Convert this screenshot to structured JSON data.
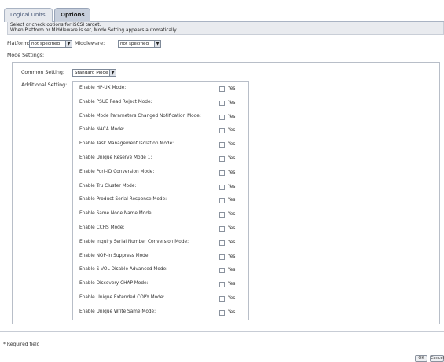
{
  "tabs": [
    {
      "label": "Logical Units",
      "active": false
    },
    {
      "label": "Options",
      "active": true
    }
  ],
  "info": {
    "line1": "Select or check options for iSCSI target.",
    "line2": "When Platform or Middleware is set, Mode Setting appears automatically."
  },
  "platform": {
    "label": "Platform:",
    "value": "not specified"
  },
  "middleware": {
    "label": "Middleware:",
    "value": "not specified"
  },
  "mode_settings_label": "Mode Settings:",
  "common_setting": {
    "label": "Common Setting:",
    "value": "Standard Mode"
  },
  "additional_setting_label": "Additional Setting:",
  "checkbox_yes_label": "Yes",
  "additional_settings": [
    {
      "label": "Enable HP-UX Mode:",
      "checked": false
    },
    {
      "label": "Enable PSUE Read Reject Mode:",
      "checked": false
    },
    {
      "label": "Enable Mode Parameters Changed Notification Mode:",
      "checked": false
    },
    {
      "label": "Enable NACA Mode:",
      "checked": false
    },
    {
      "label": "Enable Task Management Isolation Mode:",
      "checked": false
    },
    {
      "label": "Enable Unique Reserve Mode 1:",
      "checked": false
    },
    {
      "label": "Enable Port-ID Conversion Mode:",
      "checked": false
    },
    {
      "label": "Enable Tru Cluster Mode:",
      "checked": false
    },
    {
      "label": "Enable Product Serial Response Mode:",
      "checked": false
    },
    {
      "label": "Enable Same Node Name Mode:",
      "checked": false
    },
    {
      "label": "Enable CCHS Mode:",
      "checked": false
    },
    {
      "label": "Enable Inquiry Serial Number Conversion Mode:",
      "checked": false
    },
    {
      "label": "Enable NOP-In Suppress Mode:",
      "checked": false
    },
    {
      "label": "Enable S-VOL Disable Advanced Mode:",
      "checked": false
    },
    {
      "label": "Enable Discovery CHAP Mode:",
      "checked": false
    },
    {
      "label": "Enable Unique Extended COPY Mode:",
      "checked": false
    },
    {
      "label": "Enable Unique Write Same Mode:",
      "checked": false
    }
  ],
  "required_field_note": "* Required field",
  "buttons": {
    "ok": "OK",
    "cancel": "Cancel"
  },
  "colors": {
    "active_tab": "#c7cfdc",
    "info_background": "#e9ebef",
    "border": "#b8bec8"
  }
}
